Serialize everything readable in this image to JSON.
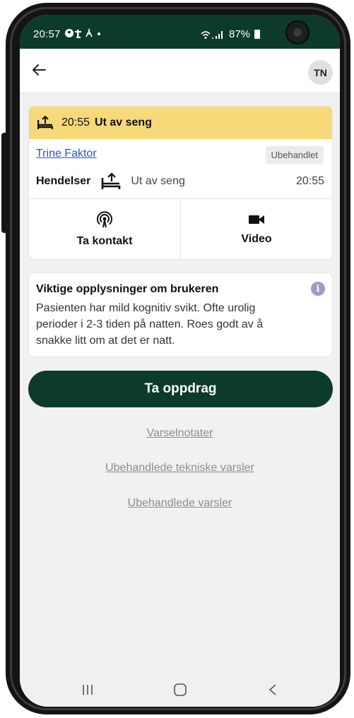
{
  "status_bar": {
    "time": "20:57",
    "left_icons": "⬤ † ✢ •",
    "signal": "≈. ∥",
    "battery_percent": "87%"
  },
  "header": {
    "back_icon": "arrow-left-icon",
    "avatar_initials": "TN"
  },
  "alarm": {
    "head_color": "#f7d97a",
    "time": "20:55",
    "title": "Ut av seng",
    "patient_name": "Trine Faktor",
    "status": "Ubehandlet",
    "events_label": "Hendelser",
    "event_text": "Ut av seng",
    "event_time": "20:55",
    "actions": [
      {
        "label": "Ta kontakt",
        "icon": "broadcast-icon"
      },
      {
        "label": "Video",
        "icon": "video-camera-icon"
      }
    ]
  },
  "info": {
    "title": "Viktige opplysninger om brukeren",
    "text": "Pasienten har mild kognitiv svikt. Ofte urolig perioder i 2-3 tiden på natten. Roes godt av å snakke litt om at det er natt.",
    "icon_glyph": "i"
  },
  "primary_button": {
    "label": "Ta oppdrag",
    "color": "#0d3b29"
  },
  "links": [
    "Varselnotater",
    "Ubehandlede tekniske varsler",
    "Ubehandlede varsler"
  ],
  "nav_bar": {
    "recents_icon": "recents-icon",
    "home_icon": "home-icon",
    "back_icon": "nav-back-icon"
  }
}
